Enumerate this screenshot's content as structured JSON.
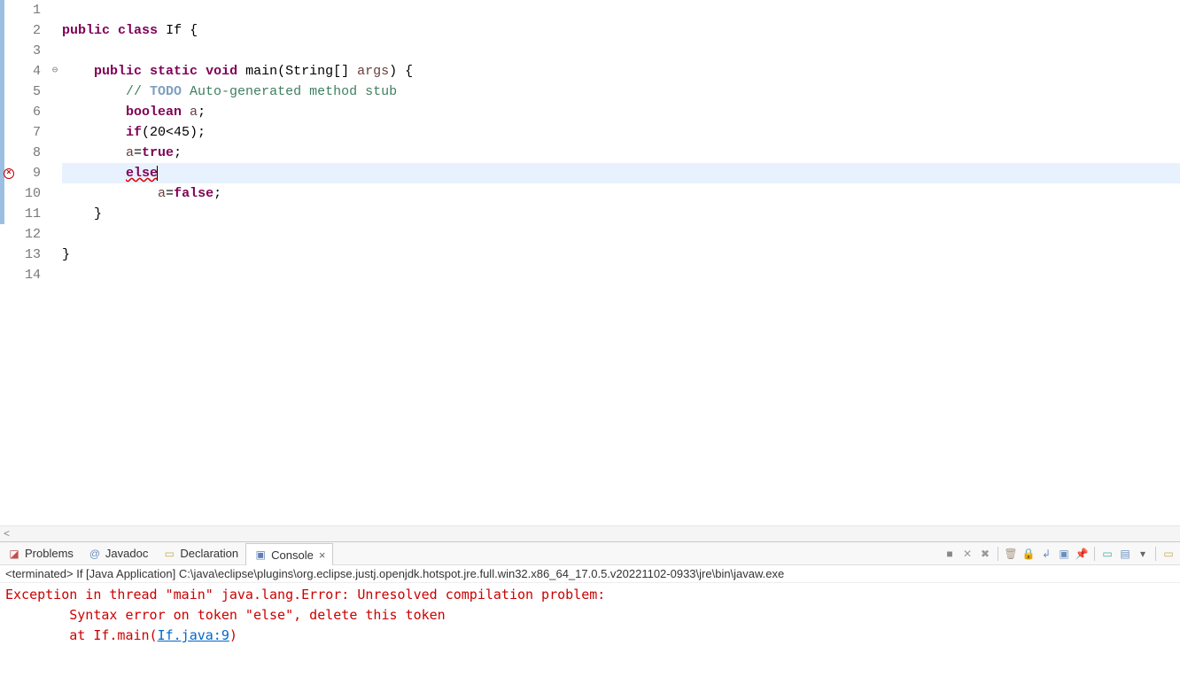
{
  "editor": {
    "lines": [
      {
        "n": 1,
        "change": true,
        "html": ""
      },
      {
        "n": 2,
        "change": true,
        "html": "<span class='kw'>public</span> <span class='kw'>class</span> <span class='typename'>If</span> {"
      },
      {
        "n": 3,
        "change": true,
        "html": ""
      },
      {
        "n": 4,
        "change": true,
        "fold": true,
        "html": "    <span class='kw'>public</span> <span class='kw'>static</span> <span class='kw'>void</span> main(String[] <span class='var'>args</span>) {"
      },
      {
        "n": 5,
        "change": true,
        "html": "        <span class='comment'>// </span><span class='todo'>TODO</span><span class='comment'> Auto-generated method stub</span>"
      },
      {
        "n": 6,
        "change": true,
        "html": "        <span class='kw'>boolean</span> <span class='var'>a</span>;"
      },
      {
        "n": 7,
        "change": true,
        "html": "        <span class='kw'>if</span>(20&lt;45);"
      },
      {
        "n": 8,
        "change": true,
        "html": "        <span class='var'>a</span>=<span class='lit'>true</span>;"
      },
      {
        "n": 9,
        "change": true,
        "error": true,
        "highlight": true,
        "html": "        <span class='kw sq-underline'>else</span><span class='cursor'></span>"
      },
      {
        "n": 10,
        "change": true,
        "html": "            <span class='var'>a</span>=<span class='lit'>false</span>;"
      },
      {
        "n": 11,
        "change": true,
        "html": "    }"
      },
      {
        "n": 12,
        "html": ""
      },
      {
        "n": 13,
        "html": "}"
      },
      {
        "n": 14,
        "html": ""
      }
    ]
  },
  "bottom": {
    "tabs": {
      "problems": "Problems",
      "javadoc": "Javadoc",
      "declaration": "Declaration",
      "console": "Console"
    },
    "console_subtitle": "<terminated> If [Java Application] C:\\java\\eclipse\\plugins\\org.eclipse.justj.openjdk.hotspot.jre.full.win32.x86_64_17.0.5.v20221102-0933\\jre\\bin\\javaw.exe",
    "console_lines": [
      {
        "cls": "con-err",
        "text": "Exception in thread \"main\" java.lang.Error: Unresolved compilation problem: "
      },
      {
        "cls": "con-err",
        "text": "\tSyntax error on token \"else\", delete this token"
      },
      {
        "cls": "con-err",
        "text": ""
      },
      {
        "cls": "con-err",
        "html": "\tat If.main(<span class='con-link' data-name='stacktrace-link' data-interactable='true'>If.java:9</span>)"
      }
    ]
  },
  "toolbar_hints": {
    "stop": "■",
    "x": "✕",
    "xx": "✖",
    "pin": "⎘",
    "lock": "🔒",
    "scroll": "⤓",
    "wrap": "↩",
    "open": "▭",
    "new": "☐",
    "dd": "▾",
    "menu": "▤"
  }
}
